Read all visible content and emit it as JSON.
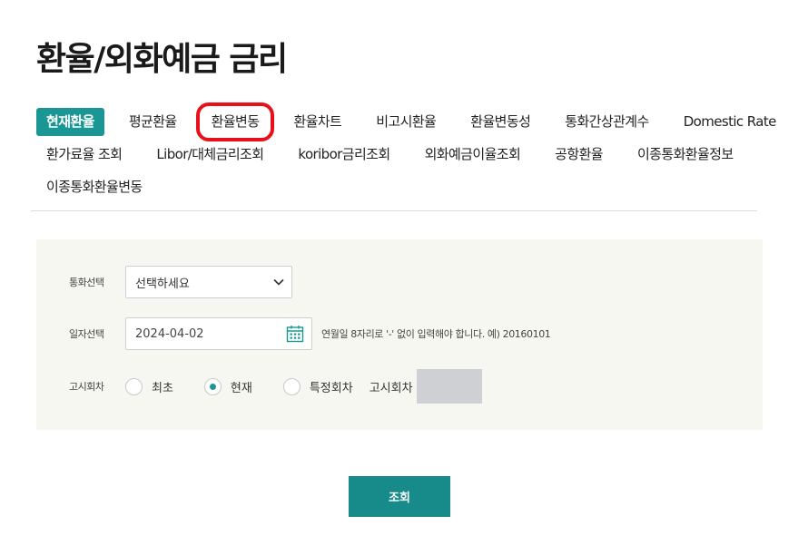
{
  "page": {
    "title": "환율/외화예금 금리"
  },
  "tabs": {
    "row1": [
      "현재환율",
      "평균환율",
      "환율변동",
      "환율차트",
      "비고시환율",
      "환율변동성",
      "통화간상관계수",
      "Domestic Rate"
    ],
    "row2": [
      "환가료율 조회",
      "Libor/대체금리조회",
      "koribor금리조회",
      "외화예금이율조회",
      "공항환율",
      "이종통화환율정보"
    ],
    "row3": [
      "이종통화환율변동"
    ],
    "active": "현재환율",
    "highlighted": "환율변동"
  },
  "form": {
    "currency": {
      "label": "통화선택",
      "value": "선택하세요"
    },
    "date": {
      "label": "일자선택",
      "value": "2024-04-02",
      "hint": "연월일 8자리로 '-' 없이 입력해야 합니다. 예) 20160101"
    },
    "round": {
      "label": "고시회차",
      "options": [
        "최초",
        "현재",
        "특정회차"
      ],
      "selected": "현재",
      "specific_label": "고시회차"
    }
  },
  "actions": {
    "query_label": "조회"
  },
  "colors": {
    "accent": "#1a9794",
    "highlight": "#e8111a",
    "panel_bg": "#f7f7f2"
  }
}
